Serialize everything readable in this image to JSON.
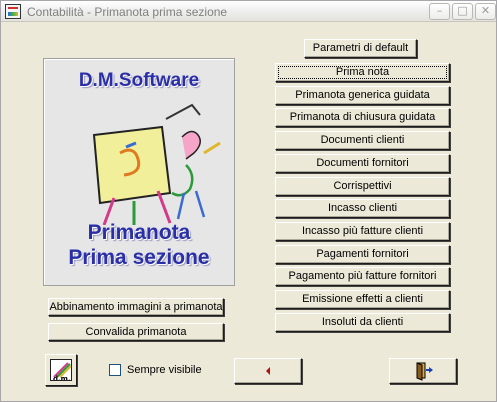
{
  "window": {
    "title": "Contabilità - Primanota prima sezione",
    "minimize_glyph": "–",
    "maximize_glyph": "□",
    "close_glyph": "✕"
  },
  "logo": {
    "brand": "D.M.Software",
    "line1": "Primanota",
    "line2": "Prima sezione",
    "alt_icon": "dm-software-logo-icon"
  },
  "buttons": {
    "default_params": "Parametri di default",
    "menu": [
      "Prima nota",
      "Primanota generica guidata",
      "Primanota di chiusura guidata",
      "Documenti clienti",
      "Documenti fornitori",
      "Corrispettivi",
      "Incasso clienti",
      "Incasso più fatture clienti",
      "Pagamenti fornitori",
      "Pagamento più fatture fornitori",
      "Emissione effetti a clienti",
      "Insoluti da clienti"
    ],
    "image_link": "Abbinamento immagini a primanota",
    "validate": "Convalida primanota"
  },
  "footer": {
    "dm_icon": "dm-software-icon",
    "always_visible_label": "Sempre visibile",
    "always_visible_checked": false,
    "back_icon": "back-arrow-icon",
    "exit_icon": "exit-door-icon"
  },
  "colors": {
    "window_bg": "#ece9d8",
    "logo_text": "#2a2fa8",
    "back_arrow": "#b01010"
  }
}
